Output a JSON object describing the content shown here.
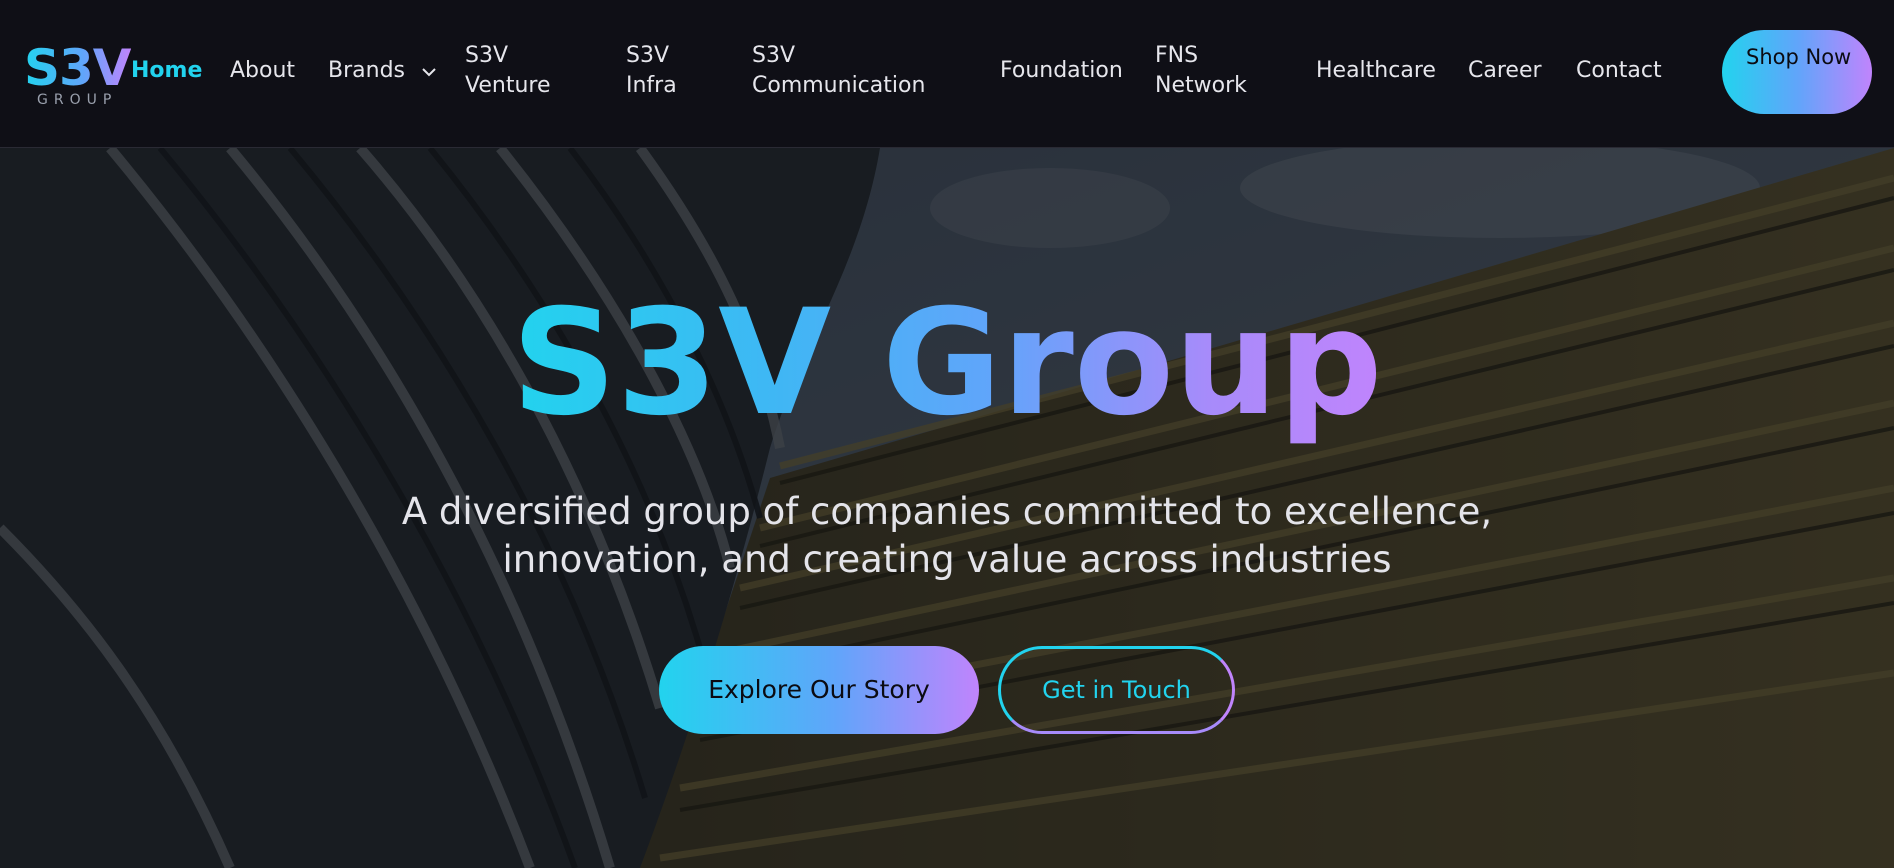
{
  "brand": {
    "logo_text": "S3V",
    "logo_sub": "GROUP"
  },
  "nav": {
    "home": "Home",
    "about": "About",
    "brands": "Brands",
    "s3v_venture": "S3V Venture",
    "s3v_infra": "S3V Infra",
    "s3v_communication": "S3V Communication",
    "foundation": "Foundation",
    "fns_network": "FNS Network",
    "healthcare": "Healthcare",
    "career": "Career",
    "contact": "Contact",
    "shop_now": "Shop Now"
  },
  "hero": {
    "title": "S3V Group",
    "subtitle": "A diversified group of companies committed to excellence, innovation, and creating value across industries",
    "primary_button": "Explore Our Story",
    "secondary_button": "Get in Touch"
  },
  "colors": {
    "accent_cyan": "#22d3ee",
    "accent_blue": "#60a5fa",
    "accent_purple": "#c084fc",
    "header_bg": "#0f0f16"
  },
  "icons": {
    "brands_dropdown": "chevron-down-icon"
  }
}
